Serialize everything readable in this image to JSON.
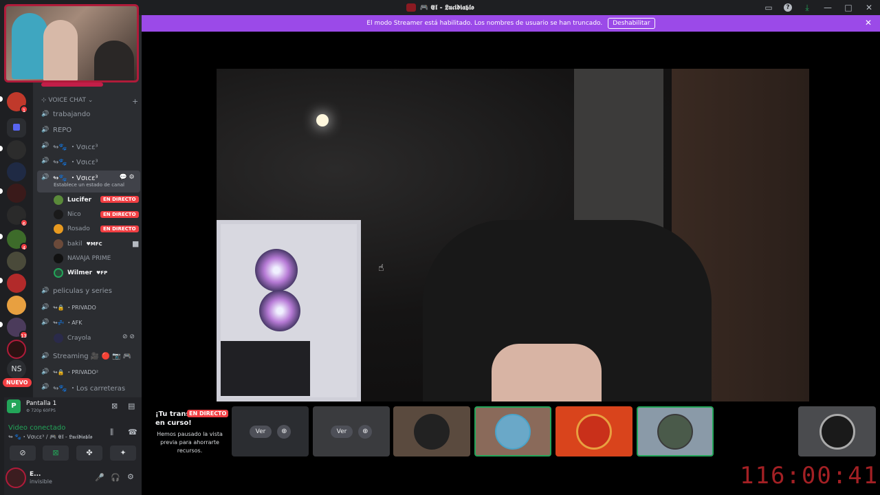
{
  "window": {
    "title": "🎮 𝕰𝖑 - 𝕷𝖚𝖈𝖎𝖉𝖎𝖆𝖇𝖑𝖔"
  },
  "banner": {
    "text": "El modo Streamer está habilitado. Los nombres de usuario se han truncado.",
    "button": "Deshabilitar"
  },
  "rail": {
    "badges": [
      "1",
      "6",
      "4",
      "13"
    ],
    "ns_label": "NS",
    "nuevo_label": "NUEVO"
  },
  "sidebar": {
    "category": "⊹ VOICE CHAT ⌄",
    "channels": [
      {
        "label": "trabajando"
      },
      {
        "label": "REPO"
      },
      {
        "label": "↬🐾 ・Vσιcε³"
      },
      {
        "label": "↬🐾 ・Vσιcε³"
      }
    ],
    "active_channel": {
      "label": "↬🐾 ・Vσιcε³",
      "status": "Establece un estado de canal"
    },
    "users": [
      {
        "name": "Lucifer",
        "tag": "",
        "live": "EN DIRECTO"
      },
      {
        "name": "Nico",
        "tag": "",
        "live": "EN DIRECTO"
      },
      {
        "name": "Rosado",
        "tag": "",
        "live": "EN DIRECTO"
      },
      {
        "name": "bakil",
        "tag": "♥MFC",
        "live": ""
      },
      {
        "name": "NAVAJA PRIME",
        "tag": "",
        "live": ""
      },
      {
        "name": "Wilmer",
        "tag": "♥FP",
        "live": ""
      }
    ],
    "channels2": [
      {
        "label": "peliculas y series"
      },
      {
        "label": "↬🔒 ・PRIVADO"
      },
      {
        "label": "↬💤 ・AFK"
      }
    ],
    "afk_user": "Crayola",
    "channels3": [
      {
        "label": "Streaming 🎥 🔴 📷 🎮"
      },
      {
        "label": "↬🔒 ・PRIVADO²"
      },
      {
        "label": "↬🐾 ・Los carreteras"
      }
    ]
  },
  "panel": {
    "screen_title": "Pantalla 1",
    "screen_sub": "⚙ 720p 60FPS",
    "voice_title": "Video conectado",
    "voice_sub": "↬ 🐾・Vσιcε³ / 🎮 𝕰𝖑 - 𝕷𝖚𝖈𝖎𝖉𝖎𝖆𝖇𝖑𝖔",
    "me_name": "E...",
    "me_status": "invisible"
  },
  "stream": {
    "live_title": "¡Tu transmisión en curso!",
    "live_badge": "EN DIRECTO",
    "paused_msg": "Hemos pausado la vista previa para ahorrarte recursos.",
    "ver_label": "Ver",
    "timer": "116:00:41"
  },
  "colors": {
    "live": "#f23f43",
    "banner": "#9b4ae8",
    "connected": "#23a559",
    "timer": "#a32024"
  }
}
